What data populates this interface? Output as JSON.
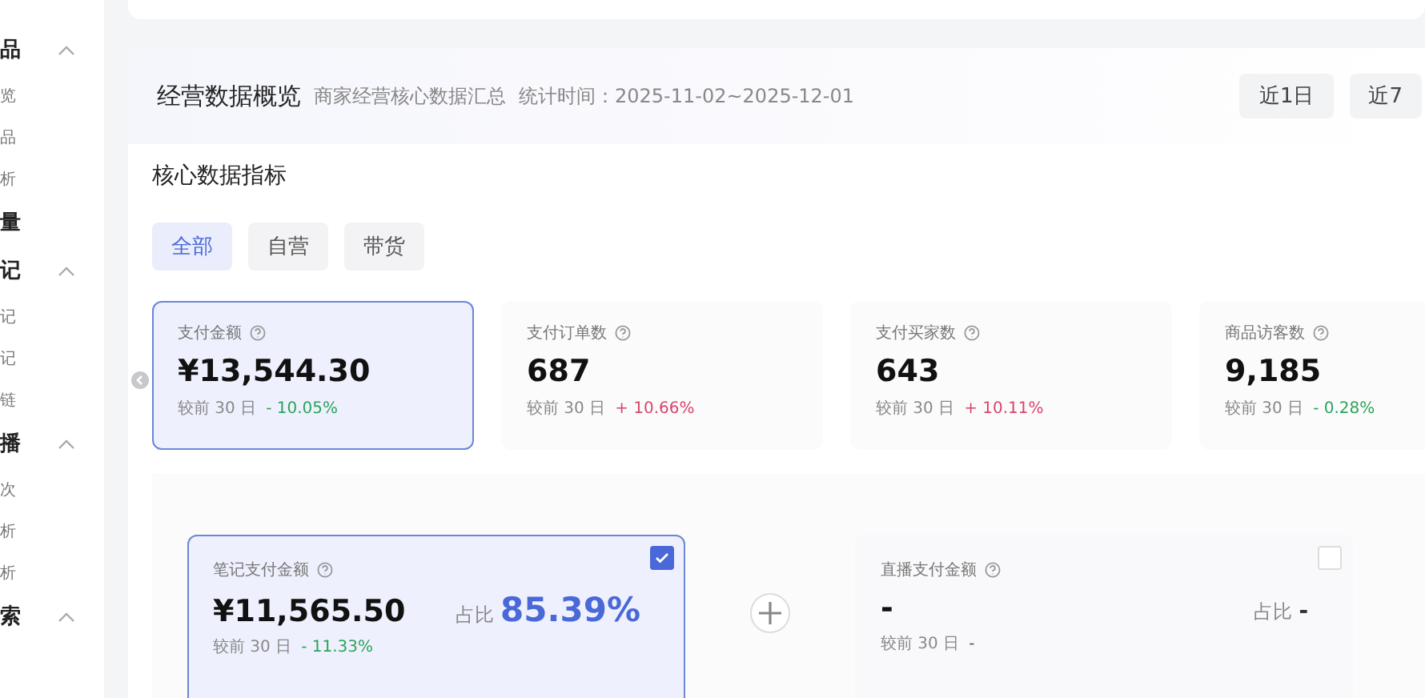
{
  "sidebar": {
    "groups": [
      {
        "title": "品",
        "expanded": true,
        "items": [
          "览",
          "品",
          "析"
        ]
      },
      {
        "title": "量"
      },
      {
        "title": "记",
        "expanded": true,
        "items": [
          "记",
          "记",
          "链"
        ]
      },
      {
        "title": "播",
        "expanded": true,
        "items": [
          "次",
          "析",
          "析"
        ]
      },
      {
        "title": "索",
        "expanded": true
      }
    ]
  },
  "overview": {
    "title": "经营数据概览",
    "subtitle": "商家经营核心数据汇总",
    "period": "统计时间：2025-11-02~2025-12-01",
    "ranges": [
      "近1日",
      "近7"
    ]
  },
  "core": {
    "title": "核心数据指标",
    "filters": [
      {
        "label": "全部",
        "selected": true
      },
      {
        "label": "自营",
        "selected": false
      },
      {
        "label": "带货",
        "selected": false
      }
    ],
    "metrics": [
      {
        "label": "支付金额",
        "value": "¥13,544.30",
        "compare": "较前 30 日",
        "delta": "- 10.05%",
        "color": "#2aa35a",
        "selected": true
      },
      {
        "label": "支付订单数",
        "value": "687",
        "compare": "较前 30 日",
        "delta": "+ 10.66%",
        "color": "#d8456a",
        "selected": false
      },
      {
        "label": "支付买家数",
        "value": "643",
        "compare": "较前 30 日",
        "delta": "+ 10.11%",
        "color": "#d8456a",
        "selected": false
      },
      {
        "label": "商品访客数",
        "value": "9,185",
        "compare": "较前 30 日",
        "delta": "- 0.28%",
        "color": "#2aa35a",
        "selected": false
      }
    ]
  },
  "breakdown": [
    {
      "label": "笔记支付金额",
      "value": "¥11,565.50",
      "share_label": "占比",
      "share": "85.39%",
      "compare": "较前 30 日",
      "delta": "- 11.33%",
      "color": "#2aa35a",
      "checked": true
    },
    {
      "label": "直播支付金额",
      "value": "-",
      "share_label": "占比",
      "share": "-",
      "compare": "较前 30 日",
      "delta": "-",
      "color": "#555555",
      "checked": false
    }
  ]
}
